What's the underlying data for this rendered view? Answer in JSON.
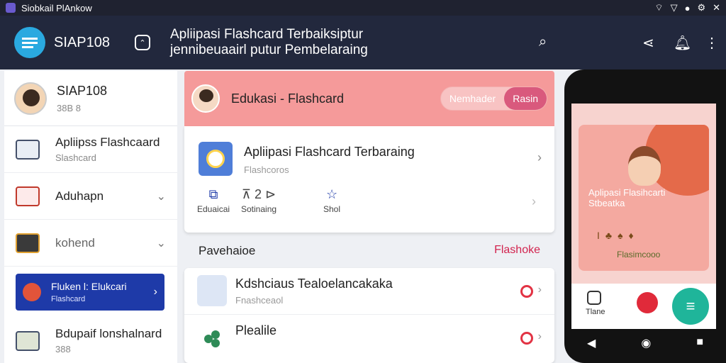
{
  "status_bar": {
    "title": "Siobkail PlAnkow"
  },
  "header": {
    "brand": "SIAP108",
    "title": "Apliipasi Flashcard Terbaiksiptur jennibeuaairl putur Pembelaraing"
  },
  "sidebar": {
    "profile": {
      "name": "SIAP108",
      "sub": "38B 8"
    },
    "items": [
      {
        "label": "Apliipss Flashcaard",
        "sub": "Slashcard"
      },
      {
        "label": "Aduhapn",
        "sub": ""
      },
      {
        "label": "kohend",
        "sub": ""
      },
      {
        "label": "Fluken l: Elukcari",
        "sub": "Flashcard"
      },
      {
        "label": "Bdupaif lonshalnard",
        "sub": "388"
      }
    ]
  },
  "main": {
    "banner": {
      "title": "Edukasi - Flashcard",
      "pill_left": "Nemhader",
      "pill_right": "Rasin"
    },
    "card": {
      "title": "Apliipasi Flashcard Terbaraing",
      "sub": "Flashcoros",
      "actions": [
        {
          "glyph": "⧉",
          "label": "Eduaicai"
        },
        {
          "glyph": "⊼ 2 ⊳",
          "label": "Sotinaing"
        },
        {
          "glyph": "☆",
          "label": "Shol"
        }
      ]
    },
    "section": {
      "title": "Pavehaioe",
      "link": "Flashoke"
    },
    "list": [
      {
        "title": "Kdshciaus Tealoelancakaka",
        "sub": "Fnashceaol"
      },
      {
        "title": "Plealile",
        "sub": ""
      }
    ]
  },
  "phone": {
    "card_title": "Aplipasi Flasihcarti Stbeatka",
    "card_sub": "Flasimcooo",
    "bar_label": "Tlane"
  }
}
